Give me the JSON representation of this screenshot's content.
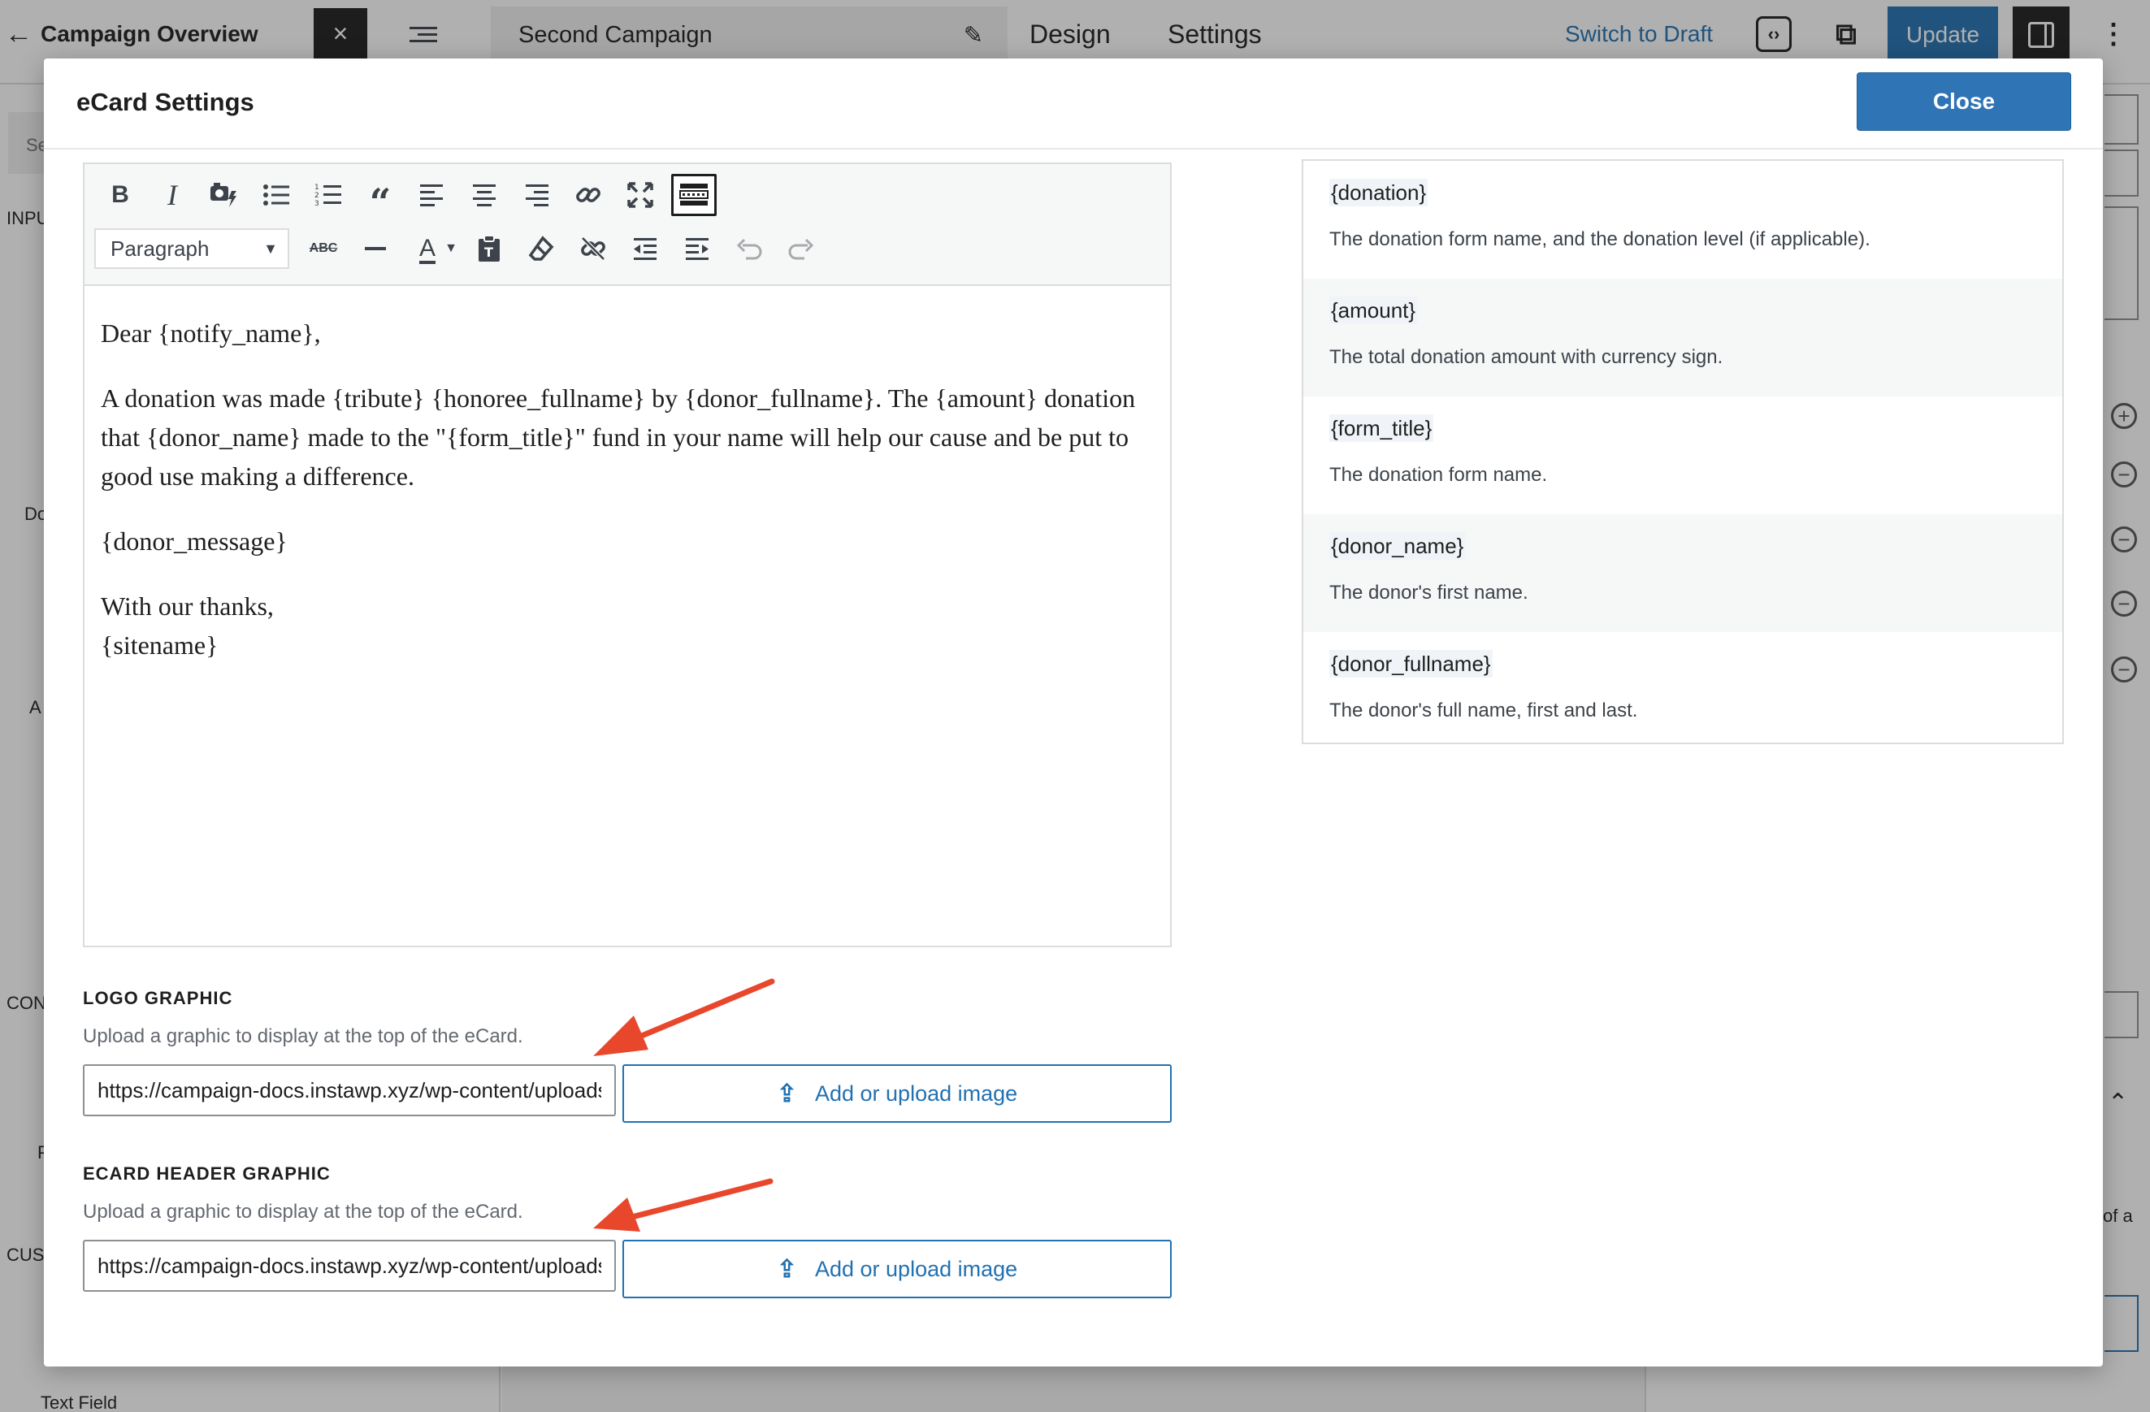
{
  "topbar": {
    "back_label": "Campaign Overview",
    "close_glyph": "×",
    "campaign_title": "Second Campaign",
    "tab_design": "Design",
    "tab_settings": "Settings",
    "switch_to_draft": "Switch to Draft",
    "update": "Update"
  },
  "background": {
    "left_labels": [
      "Se",
      "INPU",
      "Do",
      "A",
      "CON",
      "P",
      "CUS",
      "Text Field"
    ],
    "right_text": "of a"
  },
  "modal": {
    "title": "eCard Settings",
    "close_label": "Close"
  },
  "editor": {
    "format_select": "Paragraph",
    "toolbar_row1": [
      "bold-icon",
      "italic-icon",
      "add-media-icon",
      "bullet-list-icon",
      "numbered-list-icon",
      "blockquote-icon",
      "align-left-icon",
      "align-center-icon",
      "align-right-icon",
      "link-icon",
      "fullscreen-icon",
      "toolbar-toggle-icon"
    ],
    "toolbar_row2": [
      "strikethrough-icon",
      "horizontal-line-icon",
      "text-color-icon",
      "paste-text-icon",
      "clear-formatting-icon",
      "unlink-icon",
      "outdent-icon",
      "indent-icon",
      "undo-icon",
      "redo-icon"
    ],
    "content": {
      "greeting": "Dear {notify_name},",
      "body": "A donation was made {tribute} {honoree_fullname} by {donor_fullname}. The {amount} donation that {donor_name} made to the \"{form_title}\" fund in your name will help our cause and be put to good use making a difference.",
      "message": "{donor_message}",
      "closing": "With our thanks,",
      "signature": "{sitename}"
    }
  },
  "tags": [
    {
      "name": "{donation}",
      "desc": "The donation form name, and the donation level (if applicable)."
    },
    {
      "name": "{amount}",
      "desc": "The total donation amount with currency sign."
    },
    {
      "name": "{form_title}",
      "desc": "The donation form name."
    },
    {
      "name": "{donor_name}",
      "desc": "The donor's first name."
    },
    {
      "name": "{donor_fullname}",
      "desc": "The donor's full name, first and last."
    }
  ],
  "logo_graphic": {
    "label": "LOGO GRAPHIC",
    "desc": "Upload a graphic to display at the top of the eCard.",
    "value": "https://campaign-docs.instawp.xyz/wp-content/uploads/logo.png",
    "button": "Add or upload image"
  },
  "header_graphic": {
    "label": "ECARD HEADER GRAPHIC",
    "desc": "Upload a graphic to display at the top of the eCard.",
    "value": "https://campaign-docs.instawp.xyz/wp-content/uploads/header.png",
    "button": "Add or upload image"
  },
  "colors": {
    "accent": "#2271b1",
    "close_button": "#2f74b5",
    "annotation_arrow": "#e8472c"
  }
}
